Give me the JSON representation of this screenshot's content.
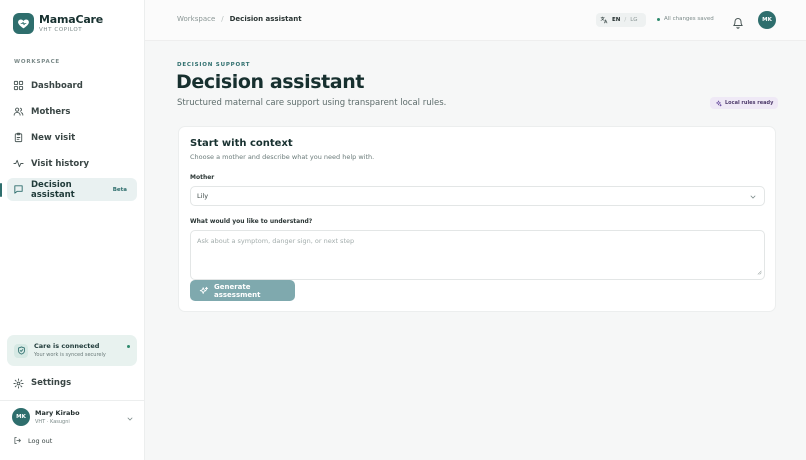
{
  "brand": {
    "name": "MamaCare",
    "subtitle": "VHT COPILOT"
  },
  "sidebar": {
    "section_label": "WORKSPACE",
    "items": [
      {
        "label": "Dashboard",
        "icon": "grid-icon"
      },
      {
        "label": "Mothers",
        "icon": "users-icon"
      },
      {
        "label": "New visit",
        "icon": "clipboard-icon"
      },
      {
        "label": "Visit history",
        "icon": "activity-icon"
      },
      {
        "label": "Decision assistant",
        "icon": "message-icon",
        "badge": "Beta",
        "active": true
      }
    ],
    "status_card": {
      "title": "Care is connected",
      "subtitle": "Your work is synced securely"
    },
    "settings_label": "Settings",
    "user": {
      "initials": "MK",
      "name": "Mary Kirabo",
      "role": "VHT · Kasugni"
    },
    "logout_label": "Log out"
  },
  "topbar": {
    "breadcrumb": [
      "Workspace",
      "Decision assistant"
    ],
    "lang_active": "EN",
    "lang_other": "LG",
    "save_status": "All changes saved",
    "avatar_initials": "MK"
  },
  "main": {
    "eyebrow": "DECISION SUPPORT",
    "title": "Decision assistant",
    "subtitle": "Structured maternal care support using transparent local rules.",
    "rules_badge": "Local rules ready",
    "card": {
      "title": "Start with context",
      "subtitle": "Choose a mother and describe what you need help with.",
      "mother_label": "Mother",
      "mother_value": "Lily",
      "question_label": "What would you like to understand?",
      "question_placeholder": "Ask about a symptom, danger sign, or next step",
      "button_label": "Generate assessment"
    }
  },
  "colors": {
    "accent": "#2e6e6d",
    "button_disabled": "#7fa9ae",
    "active_nav_bg": "#e9f1f1",
    "status_card_bg": "#e8f2ef",
    "badge_bg": "#efe9f6"
  }
}
